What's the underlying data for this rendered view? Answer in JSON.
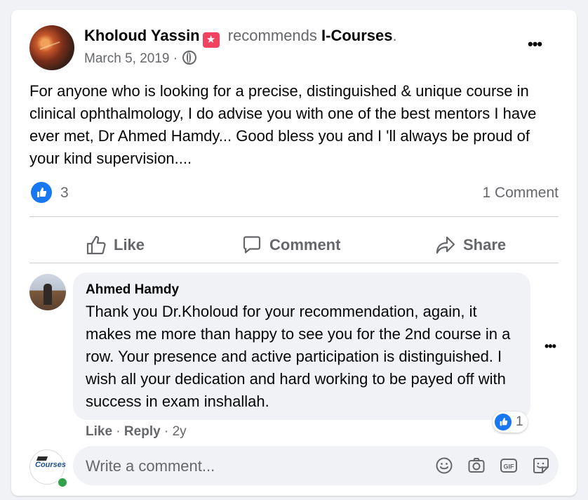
{
  "post": {
    "author_name": "Kholoud Yassin",
    "recommends_text": "recommends",
    "page_name": "I-Courses",
    "period": ".",
    "date": "March 5, 2019 ·",
    "body": "For anyone who is looking for a precise, distinguished & unique course in clinical ophthalmology, I do advise you with one of the best mentors I have ever met, Dr Ahmed Hamdy... Good bless you and I 'll always be proud of your kind supervision....",
    "like_count": "3",
    "comment_count": "1 Comment"
  },
  "actions": {
    "like": "Like",
    "comment": "Comment",
    "share": "Share"
  },
  "comment": {
    "author_name": "Ahmed Hamdy",
    "text": "Thank you Dr.Kholoud for your recommendation, again, it makes me more than happy to see you for the 2nd course in a row. Your presence and active participation is distinguished. I wish all your dedication and hard working to be payed off with success in exam inshallah.",
    "reaction_count": "1",
    "like_label": "Like",
    "reply_label": "Reply",
    "sep": " · ",
    "age": "2y"
  },
  "composer": {
    "placeholder": "Write a comment...",
    "avatar_text": "Courses"
  },
  "icons": {
    "more": "more-options-icon",
    "audience": "globe-icon",
    "emoji": "emoji-icon",
    "camera": "camera-icon",
    "gif": "gif-icon",
    "sticker": "sticker-icon"
  },
  "colors": {
    "accent": "#1877f2",
    "secondary_text": "#65676b",
    "online": "#31a24c",
    "badge": "#f3425f"
  }
}
